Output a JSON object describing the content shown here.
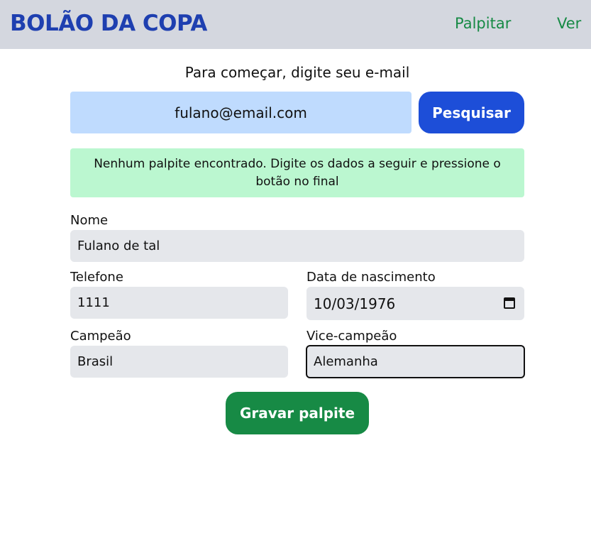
{
  "header": {
    "logo": "BOLÃO DA COPA",
    "nav": [
      {
        "label": "Palpitar"
      },
      {
        "label": "Ver"
      }
    ]
  },
  "search": {
    "prompt": "Para começar, digite seu e-mail",
    "email_value": "fulano@email.com",
    "button_label": "Pesquisar"
  },
  "notice": {
    "text": "Nenhum palpite encontrado. Digite os dados a seguir e pressione o botão no final"
  },
  "form": {
    "nome": {
      "label": "Nome",
      "value": "Fulano de tal"
    },
    "telefone": {
      "label": "Telefone",
      "value": "1111"
    },
    "nascimento": {
      "label": "Data de nascimento",
      "value": "10/03/1976"
    },
    "campeao": {
      "label": "Campeão",
      "value": "Brasil"
    },
    "vice": {
      "label": "Vice-campeão",
      "value": "Alemanha"
    },
    "submit_label": "Gravar palpite"
  },
  "colors": {
    "brand_blue": "#1e3fb0",
    "nav_green": "#178a45",
    "header_bg": "#d4d7df",
    "email_bg": "#bfdbfe",
    "notice_bg": "#bbf7d0",
    "button_blue": "#1d4ed8",
    "button_green": "#178a45",
    "field_bg": "#e5e7eb"
  }
}
